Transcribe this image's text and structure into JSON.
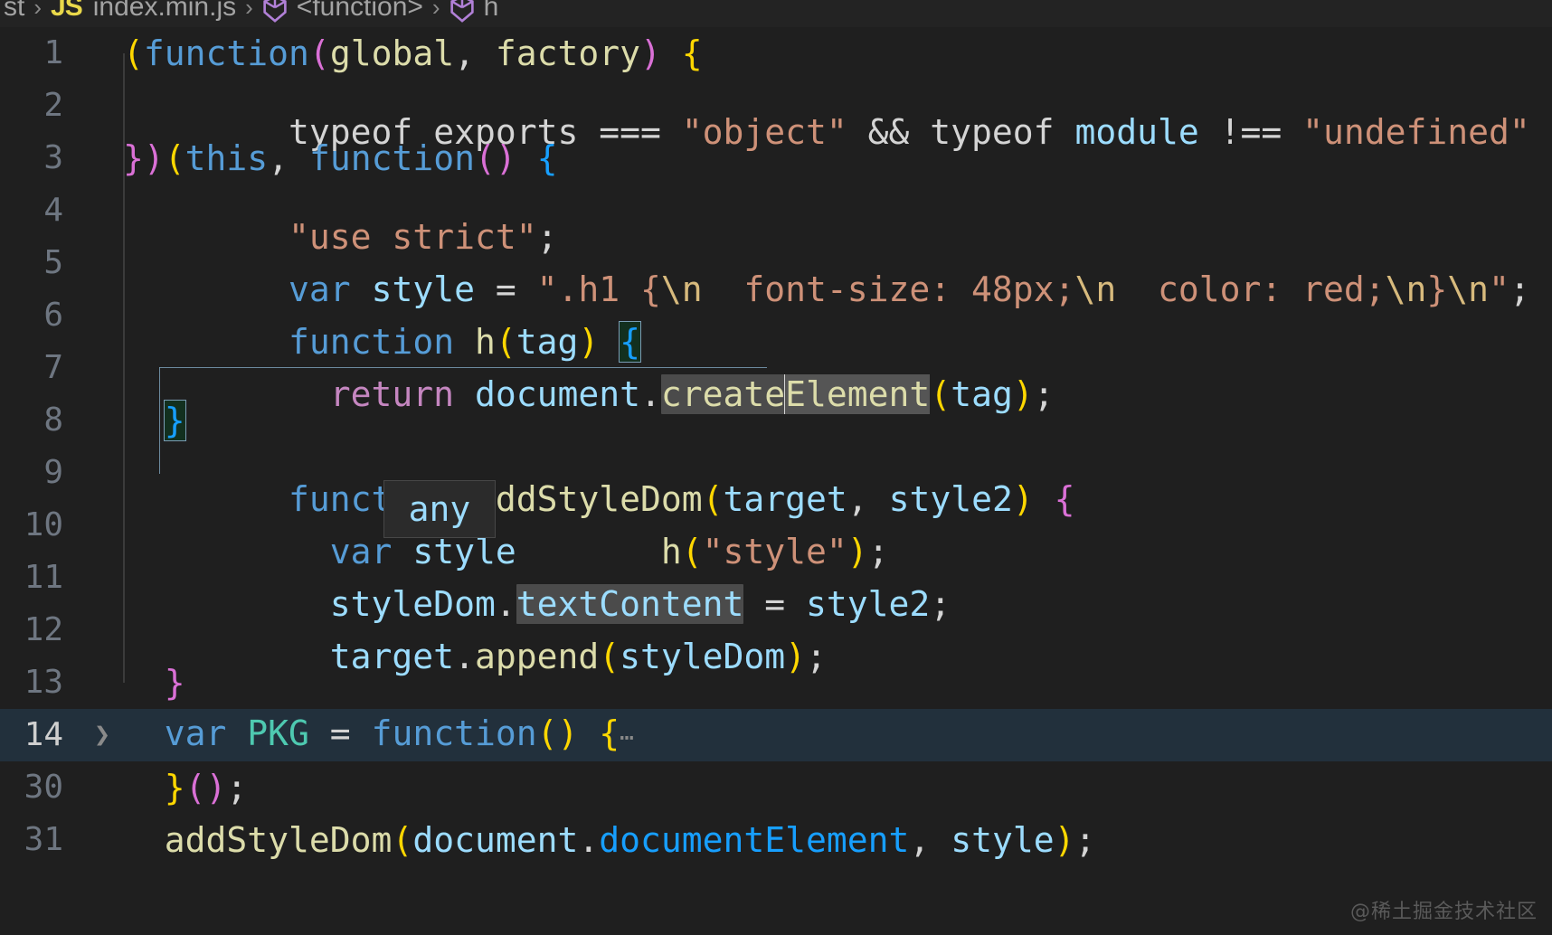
{
  "window": {
    "theme": "dark-plus",
    "background": "#1f1f1f",
    "accent": "#179fff",
    "current_line_background": "#22303c",
    "selection_background": "#4b4b4b"
  },
  "breadcrumb": {
    "items": [
      {
        "label": "st",
        "icon": ""
      },
      {
        "label": "index.min.js",
        "icon": "js-file-icon"
      },
      {
        "label": "<function>",
        "icon": "symbol-function-icon"
      },
      {
        "label": "h",
        "icon": "symbol-function-icon"
      }
    ],
    "separator": "›",
    "js_badge": "JS",
    "crumb_0": "st",
    "crumb_1": "index.min.js",
    "crumb_2": "<function>",
    "crumb_3": "h"
  },
  "editor": {
    "file_name": "index.min.js",
    "language": "JavaScript",
    "lines": [
      {
        "number": "1",
        "text": "(function(global, factory) {"
      },
      {
        "number": "2",
        "text": "  typeof exports === \"object\" && typeof module !== \"undefined\""
      },
      {
        "number": "3",
        "text": "})(this, function() {"
      },
      {
        "number": "4",
        "text": "  \"use strict\";"
      },
      {
        "number": "5",
        "text": "  var style = \".h1 {\\n  font-size: 48px;\\n  color: red;\\n}\\n\";"
      },
      {
        "number": "6",
        "text": "  function h(tag) {"
      },
      {
        "number": "7",
        "text": "    return document.createElement(tag);"
      },
      {
        "number": "8",
        "text": "  }"
      },
      {
        "number": "9",
        "text": "  function addStyleDom(target, style2) {"
      },
      {
        "number": "10",
        "text": "    var style = h(\"style\");"
      },
      {
        "number": "11",
        "text": "    styleDom.textContent = style2;"
      },
      {
        "number": "12",
        "text": "    target.append(styleDom);"
      },
      {
        "number": "13",
        "text": "  }"
      },
      {
        "number": "14",
        "text": "  var PKG = function() {⋯"
      },
      {
        "number": "30",
        "text": "  }();"
      },
      {
        "number": "31",
        "text": "  addStyleDom(document.documentElement, style);"
      }
    ],
    "current_line_number": "14",
    "folded_placeholder": "⋯",
    "fold_chevron": "❯",
    "selection_text": "createElement",
    "bracket_match_text": "{"
  },
  "tokens": {
    "l1": {
      "paren_open": "(",
      "kw_function": "function",
      "paren2": "(",
      "p_global": "global",
      "comma": ", ",
      "p_factory": "factory",
      "paren_close": ")",
      "brace": " {"
    },
    "l2": {
      "typeof1": "typeof ",
      "exports": "exports",
      "eq": " === ",
      "str_object": "\"object\"",
      "and": " && ",
      "typeof2": "typeof ",
      "module": "module",
      "neq": " !== ",
      "str_undefined": "\"undefined\""
    },
    "l3": {
      "close": "})",
      "paren": "(",
      "this": "this",
      "comma": ", ",
      "kw_function": "function",
      "parens": "()",
      "brace": " {"
    },
    "l4": {
      "str": "\"use strict\"",
      "semi": ";"
    },
    "l5": {
      "kw_var": "var ",
      "name": "style",
      "eq": " = ",
      "q1": "\"",
      "s1": ".h1 {",
      "e1": "\\n",
      "s2": "  font-size: 48px;",
      "e2": "\\n",
      "s3": "  color: red;",
      "e3": "\\n",
      "s4": "}",
      "e4": "\\n",
      "q2": "\"",
      "semi": ";"
    },
    "l6": {
      "kw_function": "function ",
      "name": "h",
      "paren": "(",
      "arg": "tag",
      "parenc": ")",
      "brace": "{"
    },
    "l7": {
      "kw_return": "return ",
      "obj": "document",
      "dot": ".",
      "sel_a": "create",
      "sel_b": "Element",
      "paren": "(",
      "arg": "tag",
      "parenc": ")",
      "semi": ";"
    },
    "l8": {
      "brace": "}"
    },
    "l9": {
      "kw_function": "function ",
      "name": "addStyleDom",
      "paren": "(",
      "a1": "target",
      "comma": ", ",
      "a2": "style2",
      "parenc": ")",
      "brace": " {"
    },
    "l10": {
      "kw_var": "var ",
      "name": "style",
      "eq": "",
      "call": " h",
      "paren": "(",
      "str": "\"style\"",
      "parenc": ")",
      "semi": ";"
    },
    "l11": {
      "obj": "styleDom",
      "dot": ".",
      "prop": "textContent",
      "eq": " = ",
      "val": "style2",
      "semi": ";"
    },
    "l12": {
      "obj": "target",
      "dot": ".",
      "method": "append",
      "paren": "(",
      "arg": "styleDom",
      "parenc": ")",
      "semi": ";"
    },
    "l13": {
      "brace": "}"
    },
    "l14": {
      "kw_var": "var ",
      "name": "PKG",
      "eq": " = ",
      "kw_function": "function",
      "parens": "()",
      "brace": " {",
      "fold": "⋯"
    },
    "l30": {
      "brace": "}",
      "parens": "()",
      "semi": ";"
    },
    "l31": {
      "call": "addStyleDom",
      "paren": "(",
      "obj": "document",
      "dot": ".",
      "prop": "documentElement",
      "comma": ", ",
      "arg": "style",
      "parenc": ")",
      "semi": ";"
    }
  },
  "hover_tooltip": {
    "text": "any",
    "visible": true
  },
  "watermark": {
    "text": "@稀土掘金技术社区"
  }
}
